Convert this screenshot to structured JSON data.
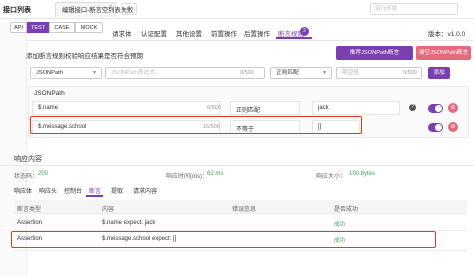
{
  "topbar": {
    "app_title": "接口列表",
    "doc_tab_label": "编辑接口-断言空列表失败",
    "close_glyph": "×",
    "add_glyph": "+",
    "env_placeholder": "运行环境"
  },
  "segments": [
    "API",
    "TEST",
    "CASE",
    "MOCK"
  ],
  "request_tabs": [
    {
      "label": "请求体",
      "active": false
    },
    {
      "label": "认证配置",
      "active": false
    },
    {
      "label": "其他设置",
      "active": false
    },
    {
      "label": "前置操作",
      "active": false
    },
    {
      "label": "后置操作",
      "active": false
    },
    {
      "label": "断言规则",
      "active": true
    }
  ],
  "assert_count": "2",
  "version": "版本：v1.0.0",
  "assertion_panel": {
    "description": "添加断言规则校验响应结果是否符合预期",
    "btn_jsonpath": "推荐JSONPath断言",
    "btn_clear": "清空JSONPath断言",
    "new_row": {
      "type_value": "JSONPath",
      "expr_placeholder": "JSONPath表达式",
      "expr_count": "0/500",
      "match_value": "正则匹配",
      "expect_placeholder": "期望值",
      "expect_count": "0/500",
      "add_label": "添加"
    },
    "jsonpath_label": "JSONPath",
    "rows": [
      {
        "path": "$.name",
        "count": "6/500",
        "matcher": "正则匹配",
        "expected": "jack",
        "enabled": true
      },
      {
        "path": "$.message.school",
        "count": "16/500",
        "matcher": "不等于",
        "expected": "[]",
        "enabled": true
      }
    ]
  },
  "response": {
    "title": "响应内容",
    "status_label": "状态码：",
    "status_value": "200",
    "time_label": "响应时间(ms)：",
    "time_value": "62 ms",
    "size_label": "响应大小：",
    "size_value": "100 bytes",
    "tabs": [
      {
        "label": "响应体",
        "active": false
      },
      {
        "label": "响应头",
        "active": false
      },
      {
        "label": "控制台",
        "active": false
      },
      {
        "label": "断言",
        "active": true
      },
      {
        "label": "提取",
        "active": false
      },
      {
        "label": "请求内容",
        "active": false
      }
    ],
    "table_headers": [
      "断言类型",
      "内容",
      "错误信息",
      "是否成功"
    ],
    "results": [
      {
        "type": "Assertion",
        "content": "$.name expect: jack",
        "error": "",
        "success": "成功"
      },
      {
        "type": "Assertion",
        "content": "$.message.school expect: []",
        "error": "",
        "success": "成功"
      }
    ]
  },
  "colors": {
    "accent": "#7b3fb1",
    "danger": "#e46a7b",
    "success": "#3aa55a",
    "highlight": "#e03a2a"
  }
}
